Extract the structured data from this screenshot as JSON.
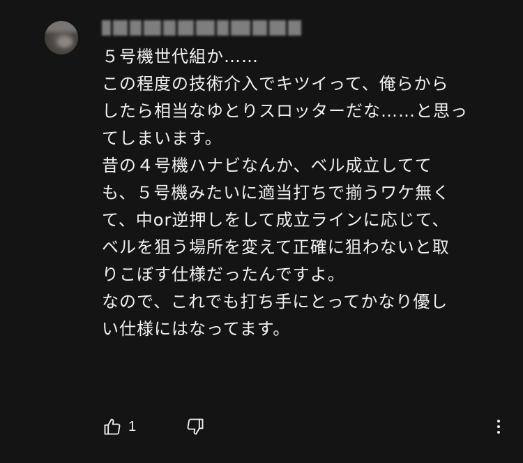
{
  "comment": {
    "lines": [
      "５号機世代組か……",
      "この程度の技術介入でキツイって、俺らから",
      "したら相当なゆとりスロッターだな……と思っ",
      "てしまいます。",
      "昔の４号機ハナビなんか、ベル成立してて",
      "も、５号機みたいに適当打ちで揃うワケ無く",
      "て、中or逆押しをして成立ラインに応じて、",
      "ベルを狙う場所を変えて正確に狙わないと取",
      "りこぼす仕様だったんですよ。",
      "なので、これでも打ち手にとってかなり優し",
      "い仕様にはなってます。"
    ]
  },
  "actions": {
    "like_count": "1",
    "like_icon": "thumbs-up-icon",
    "dislike_icon": "thumbs-down-icon",
    "more_icon": "more-vertical-icon"
  },
  "colors": {
    "background": "#141414",
    "text": "#f1f1f1"
  }
}
